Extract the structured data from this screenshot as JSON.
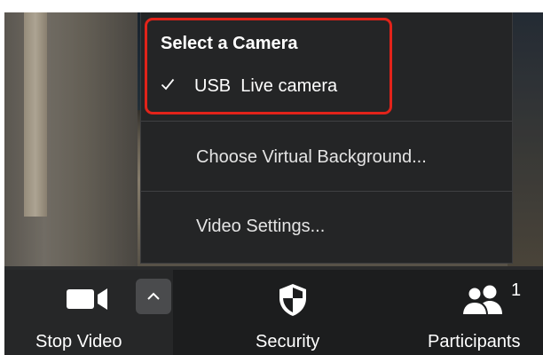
{
  "camera_menu": {
    "heading": "Select a Camera",
    "selected_camera": "USB  Live camera",
    "items": [
      {
        "label": "Choose Virtual Background..."
      },
      {
        "label": "Video Settings..."
      }
    ]
  },
  "toolbar": {
    "buttons": [
      {
        "label": "Stop Video",
        "icon": "video-camera-icon"
      },
      {
        "label": "Security",
        "icon": "shield-icon"
      },
      {
        "label": "Participants",
        "icon": "participants-icon",
        "count": "1"
      }
    ]
  },
  "colors": {
    "highlight": "#e2231a",
    "menu_bg": "#242526",
    "toolbar_bg": "#1c1d1e"
  }
}
